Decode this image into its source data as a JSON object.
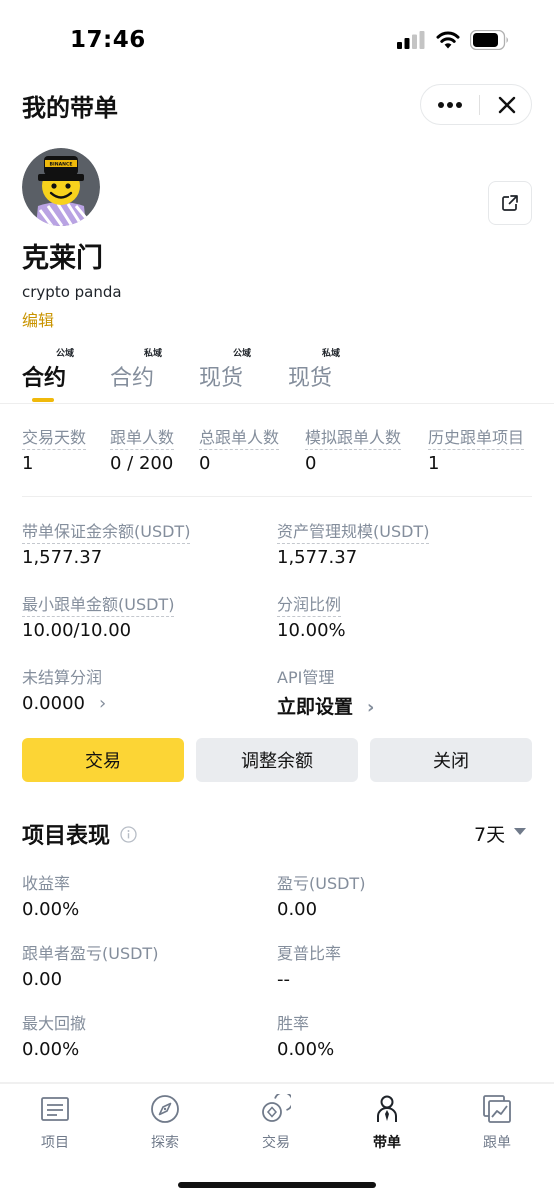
{
  "status_bar": {
    "time": "17:46"
  },
  "header": {
    "title": "我的带单"
  },
  "profile": {
    "name": "克莱门",
    "subtitle": "crypto panda",
    "edit_label": "编辑",
    "avatar_hat_text": "BINANCE"
  },
  "tabs": [
    {
      "label": "合约",
      "badge": "公域",
      "active": true
    },
    {
      "label": "合约",
      "badge": "私域",
      "active": false
    },
    {
      "label": "现货",
      "badge": "公域",
      "active": false
    },
    {
      "label": "现货",
      "badge": "私域",
      "active": false
    }
  ],
  "stats": [
    {
      "label": "交易天数",
      "value": "1"
    },
    {
      "label": "跟单人数",
      "value": "0 / 200"
    },
    {
      "label": "总跟单人数",
      "value": "0"
    },
    {
      "label": "模拟跟单人数",
      "value": "0"
    },
    {
      "label": "历史跟单项目",
      "value": "1"
    }
  ],
  "finance": {
    "margin_balance": {
      "label": "带单保证金余额(USDT)",
      "value": "1,577.37"
    },
    "aum": {
      "label": "资产管理规模(USDT)",
      "value": "1,577.37"
    },
    "min_copy": {
      "label": "最小跟单金额(USDT)",
      "value": "10.00/10.00"
    },
    "profit_share": {
      "label": "分润比例",
      "value": "10.00%"
    },
    "unsettled": {
      "label": "未结算分润",
      "value": "0.0000"
    },
    "api": {
      "label": "API管理",
      "value": "立即设置"
    }
  },
  "actions": {
    "trade": "交易",
    "adjust": "调整余额",
    "close": "关闭"
  },
  "performance": {
    "title": "项目表现",
    "period": "7天",
    "metrics": {
      "roi": {
        "label": "收益率",
        "value": "0.00%"
      },
      "pnl": {
        "label": "盈亏(USDT)",
        "value": "0.00"
      },
      "follower_pnl": {
        "label": "跟单者盈亏(USDT)",
        "value": "0.00"
      },
      "sharpe": {
        "label": "夏普比率",
        "value": "--"
      },
      "mdd": {
        "label": "最大回撤",
        "value": "0.00%"
      },
      "winrate": {
        "label": "胜率",
        "value": "0.00%"
      }
    }
  },
  "bottom_nav": [
    {
      "label": "项目",
      "icon": "list-icon"
    },
    {
      "label": "探索",
      "icon": "compass-icon"
    },
    {
      "label": "交易",
      "icon": "coins-icon"
    },
    {
      "label": "带单",
      "icon": "lead-person-icon",
      "active": true
    },
    {
      "label": "跟单",
      "icon": "chart-icon"
    }
  ],
  "colors": {
    "accent": "#fcd535",
    "accent_text": "#c99400",
    "muted": "#848e9c",
    "button_gray": "#eaecef"
  }
}
